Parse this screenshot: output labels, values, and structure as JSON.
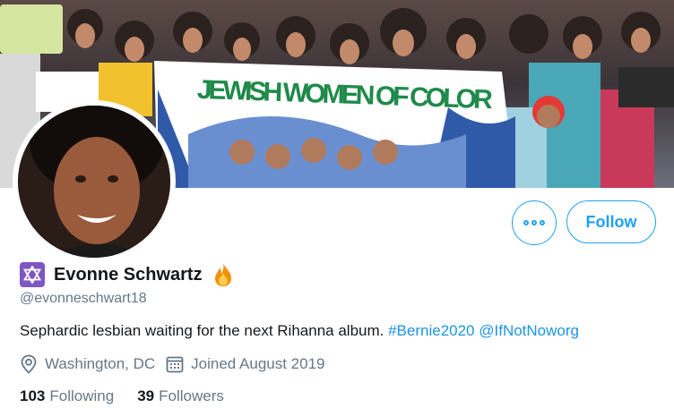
{
  "banner": {
    "sign_text": "JEWISH WOMEN OF COLOR"
  },
  "actions": {
    "follow_label": "Follow"
  },
  "profile": {
    "display_name": "Evonne Schwartz",
    "handle": "@evonneschwart18",
    "bio_text": "Sephardic lesbian waiting for the next Rihanna album. ",
    "bio_hashtag": "#Bernie2020",
    "bio_mention": "@IfNotNoworg",
    "location": "Washington, DC",
    "joined": "Joined August 2019"
  },
  "stats": {
    "following_count": "103",
    "following_label": "Following",
    "followers_count": "39",
    "followers_label": "Followers"
  },
  "colors": {
    "accent": "#1da1f2",
    "secondary_text": "#657786",
    "badge": "#7e57c2"
  },
  "icons": [
    "more-icon",
    "star-of-david-icon",
    "fire-icon",
    "location-icon",
    "calendar-icon"
  ]
}
